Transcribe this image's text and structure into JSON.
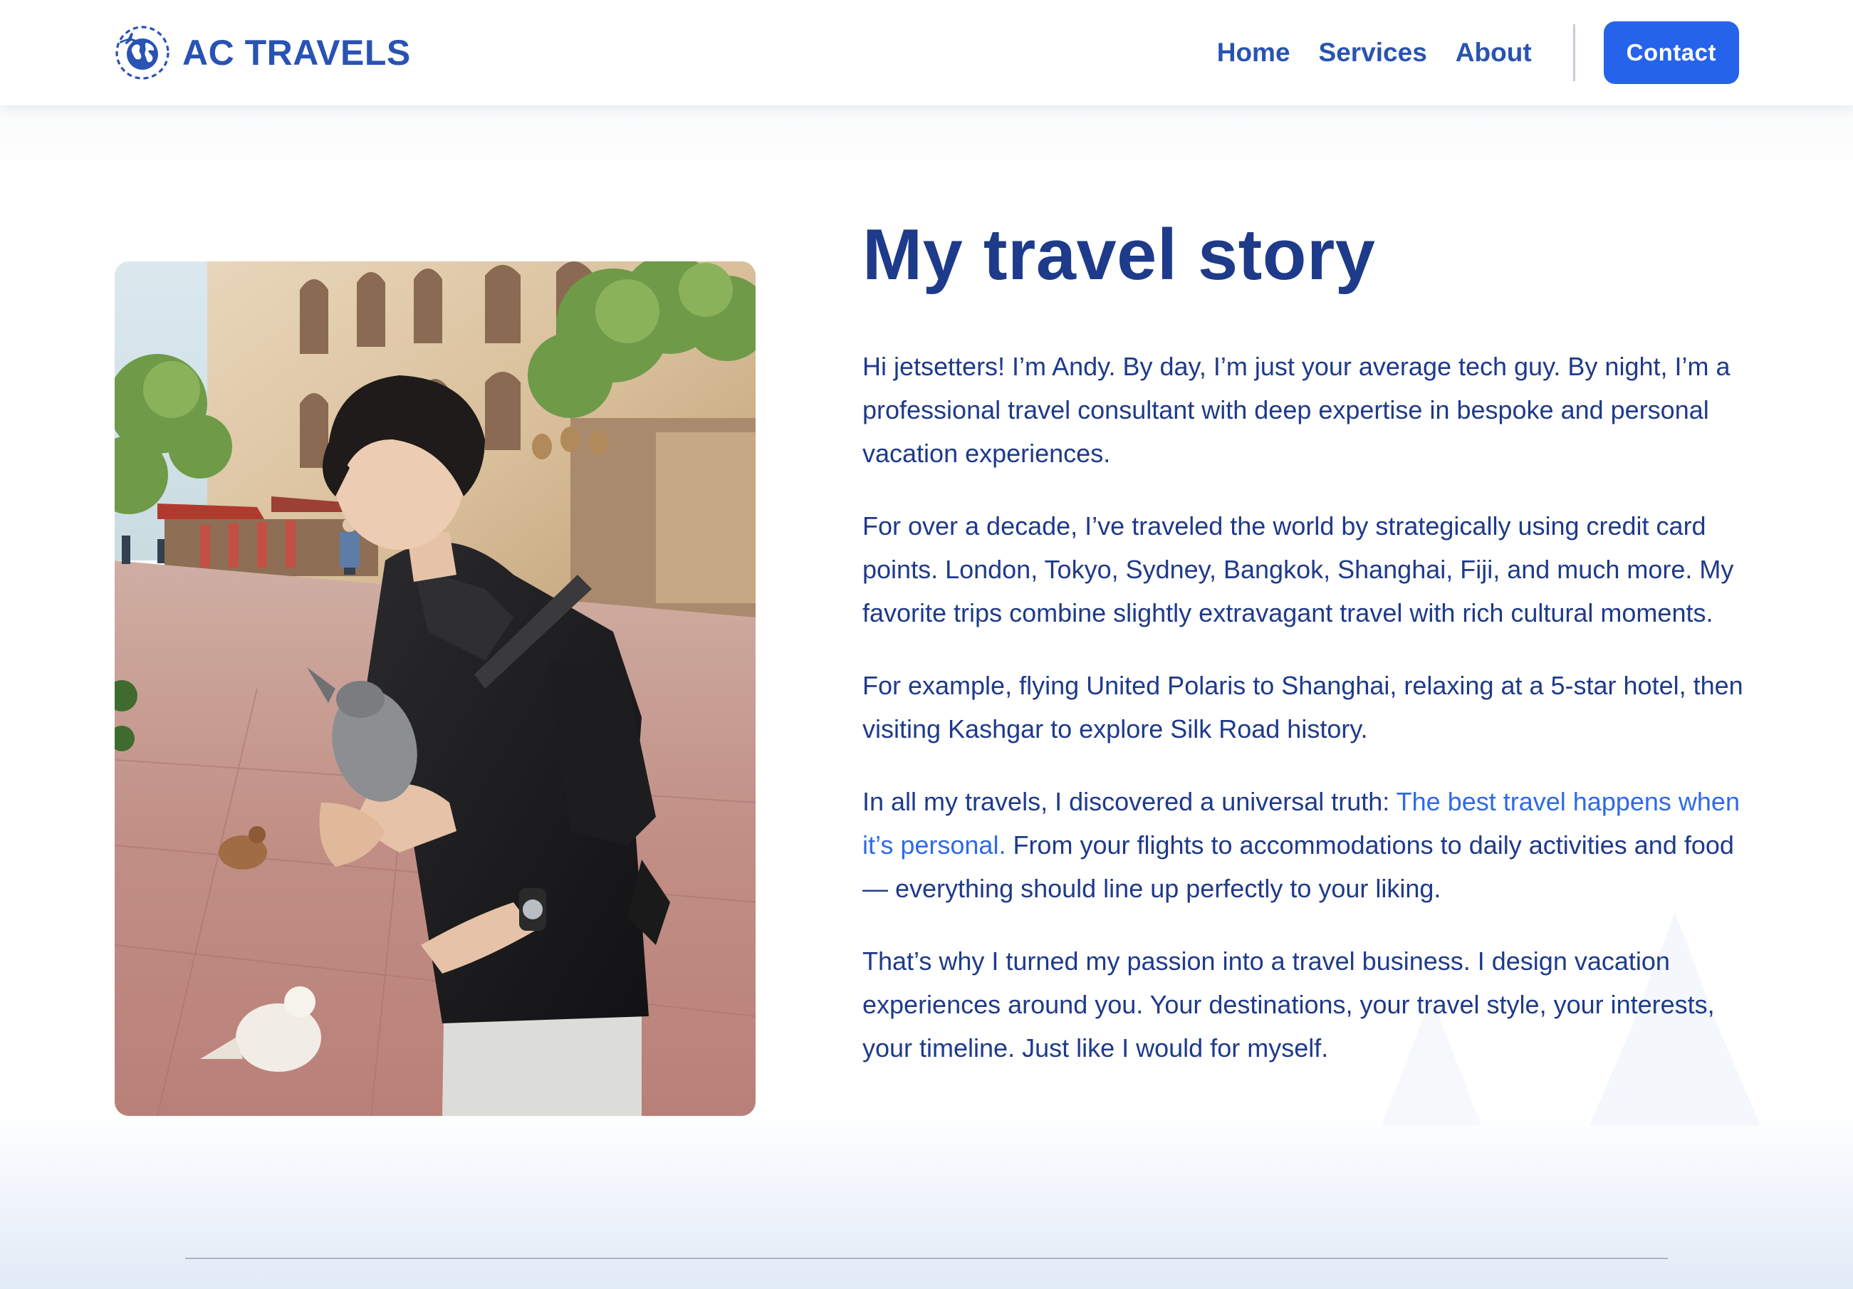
{
  "brand": {
    "name": "AC TRAVELS",
    "logo_icon": "globe-with-airplane-icon",
    "color": "#2853b3"
  },
  "nav": {
    "items": [
      {
        "label": "Home"
      },
      {
        "label": "Services"
      },
      {
        "label": "About"
      }
    ],
    "contact_label": "Contact",
    "contact_color": "#2563eb"
  },
  "story": {
    "title": "My travel story",
    "paragraphs": [
      "Hi jetsetters! I’m Andy. By day, I’m just your average tech guy. By night, I’m a professional travel consultant with deep expertise in bespoke and personal vacation experiences.",
      "For over a decade, I’ve traveled the world by strategically using credit card points. London, Tokyo, Sydney, Bangkok, Shanghai, Fiji, and much more. My favorite trips combine slightly extravagant travel with rich cultural moments.",
      "For example, flying United Polaris to Shanghai, relaxing at a 5-star hotel, then visiting Kashgar to explore Silk Road history."
    ],
    "truth": {
      "before": "In all my travels, I discovered a universal truth: ",
      "highlight": "The best travel happens when it’s personal.",
      "after": " From your flights to accommodations to daily activities and food — everything should line up perfectly to your liking."
    },
    "closing": "That’s why I turned my passion into a travel business. I design vacation experiences around you. Your destinations, your travel style, your interests, your timeline. Just like I would for myself.",
    "text_color": "#1e3a8a",
    "highlight_color": "#2f6ae6"
  },
  "photo": {
    "subject": "traveler-with-pigeons-photo"
  }
}
